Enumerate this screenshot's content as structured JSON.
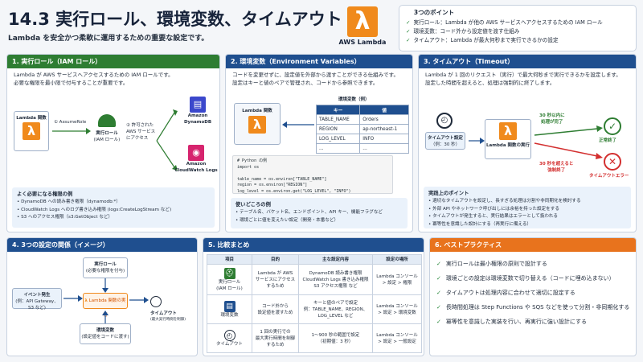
{
  "header": {
    "title": "14.3 実行ロール、環境変数、タイムアウト",
    "subtitle": "Lambda を安全かつ柔軟に運用するための重要な設定です。",
    "logo_label": "AWS Lambda"
  },
  "points": {
    "title": "3つのポイント",
    "items": [
      "実行ロール：Lambda が他の AWS サービスへアクセスするための IAM ロール",
      "環境変数：コード外から設定値を渡す仕組み",
      "タイムアウト：Lambda が最大何秒まで実行できるかの設定"
    ]
  },
  "role": {
    "header": "1. 実行ロール（IAM ロール）",
    "desc1": "Lambda が AWS サービスへアクセスするための IAM ロールです。",
    "desc2": "必要な権限を最小限で付与することが重要です。",
    "lambda_label": "Lambda 関数",
    "assume": "① AssumeRole",
    "role_label1": "実行ロール",
    "role_label2": "(IAM ロール)",
    "allowed1": "② 許可された",
    "allowed2": "AWS サービス",
    "allowed3": "にアクセス",
    "dynamo1": "Amazon",
    "dynamo2": "DynamoDB",
    "cw1": "Amazon",
    "cw2": "CloudWatch Logs",
    "list_title": "よく必要になる権限の例",
    "list": [
      "DynamoDB への読み書き権限（dynamodb:*）",
      "CloudWatch Logs へのログ書き込み権限 (logs:CreateLogStream など)",
      "S3 へのアクセス権限（s3:GetObject など）"
    ]
  },
  "env": {
    "header": "2. 環境変数（Environment Variables）",
    "desc1": "コードを変更せずに、設定値を外部から渡すことができる仕組みです。",
    "desc2": "設定はキーと値のペアで管理され、コードから参照できます。",
    "lambda_label": "Lambda 関数",
    "table_title": "環境変数（例）",
    "table_head": [
      "キー",
      "値"
    ],
    "rows": [
      [
        "TABLE_NAME",
        "Orders"
      ],
      [
        "REGION",
        "ap-northeast-1"
      ],
      [
        "LOG_LEVEL",
        "INFO"
      ],
      [
        "...",
        "..."
      ]
    ],
    "code": "# Python の例\nimport os\n\ntable_name = os.environ[\"TABLE_NAME\"]\nregion = os.environ[\"REGION\"]\nlog_level = os.environ.get(\"LOG_LEVEL\", \"INFO\")",
    "list_title": "使いどころの例",
    "list": [
      "テーブル名、バケット名、エンドポイント、API キー、機能フラグなど",
      "環境ごとに値を変えたい設定（開発・本番など）"
    ]
  },
  "timeout": {
    "header": "3. タイムアウト（Timeout）",
    "desc1": "Lambda が 1 回のリクエスト（実行）で最大何秒まで実行できるかを設定します。",
    "desc2": "設定した時間を超えると、処理は強制的に終了します。",
    "setting1": "タイムアウト設定",
    "setting2": "（例：30 秒）",
    "func_label": "Lambda 関数の実行",
    "ok1": "30 秒以内に",
    "ok2": "処理が完了",
    "ok_end": "正常終了",
    "ng1": "30 秒を超えると",
    "ng2": "強制終了",
    "ng_end": "タイムアウトエラー",
    "list_title": "実践上のポイント",
    "list": [
      "適切なタイムアウトを設定し、長すぎる処理は分割や非同期化を検討する",
      "外部 API やネットワーク呼び出しには余裕を持った設定をする",
      "タイムアウトが発生すると、実行結果はエラーとして扱われる",
      "冪等性を意識した設計にする（再実行に備える）"
    ]
  },
  "relation": {
    "header": "4. 3つの設定の関係（イメージ）",
    "role1": "実行ロール",
    "role2": "(必要な権限を付与)",
    "event1": "イベント発生",
    "event2": "(例：API Gateway、S3 など)",
    "func": "Lambda 関数の実行",
    "timeout1": "タイムアウト",
    "timeout2": "(最大実行時間を制御)",
    "env1": "環境変数",
    "env2": "(設定値をコードに渡す)"
  },
  "compare": {
    "header": "5. 比較まとめ",
    "head": [
      "項目",
      "目的",
      "主な設定内容",
      "設定の場所"
    ],
    "rows": [
      {
        "name": "実行ロール\n(IAM ロール)",
        "purpose": "Lambda が AWS\nサービスにアクセス\nするため",
        "content": "DynamoDB 読み書き権限\nCloudWatch Logs 書き込み権限\nS3 アクセス権限 など",
        "where": "Lambda コンソール\n> 設定 > 権限"
      },
      {
        "name": "環境変数",
        "purpose": "コード外から\n設定値を渡すため",
        "content": "キーと値のペアで設定\n例：TABLE_NAME、REGION、\nLOG_LEVEL など",
        "where": "Lambda コンソール\n> 設定 > 環境変数"
      },
      {
        "name": "タイムアウト",
        "purpose": "1 回の実行での\n最大実行時間を制御\nするため",
        "content": "1〜900 秒の範囲で設定\n（初期値：3 秒）",
        "where": "Lambda コンソール\n> 設定 > 一般設定"
      }
    ]
  },
  "practice": {
    "header": "6. ベストプラクティス",
    "items": [
      "実行ロールは最小権限の原則で設計する",
      "環境ごとの設定は環境変数で切り替える（コードに埋め込まない）",
      "タイムアウトは処理内容に合わせて適切に設定する",
      "長時間処理は Step Functions や SQS などを使って分割・非同期化する",
      "冪等性を意識した実装を行い、再実行に強い設計にする"
    ]
  },
  "colors": {
    "green": "#2e7d32",
    "blue": "#1f4f8f",
    "orange": "#e8731d",
    "lambda": "#f08a1c",
    "error": "#d32f2f"
  }
}
